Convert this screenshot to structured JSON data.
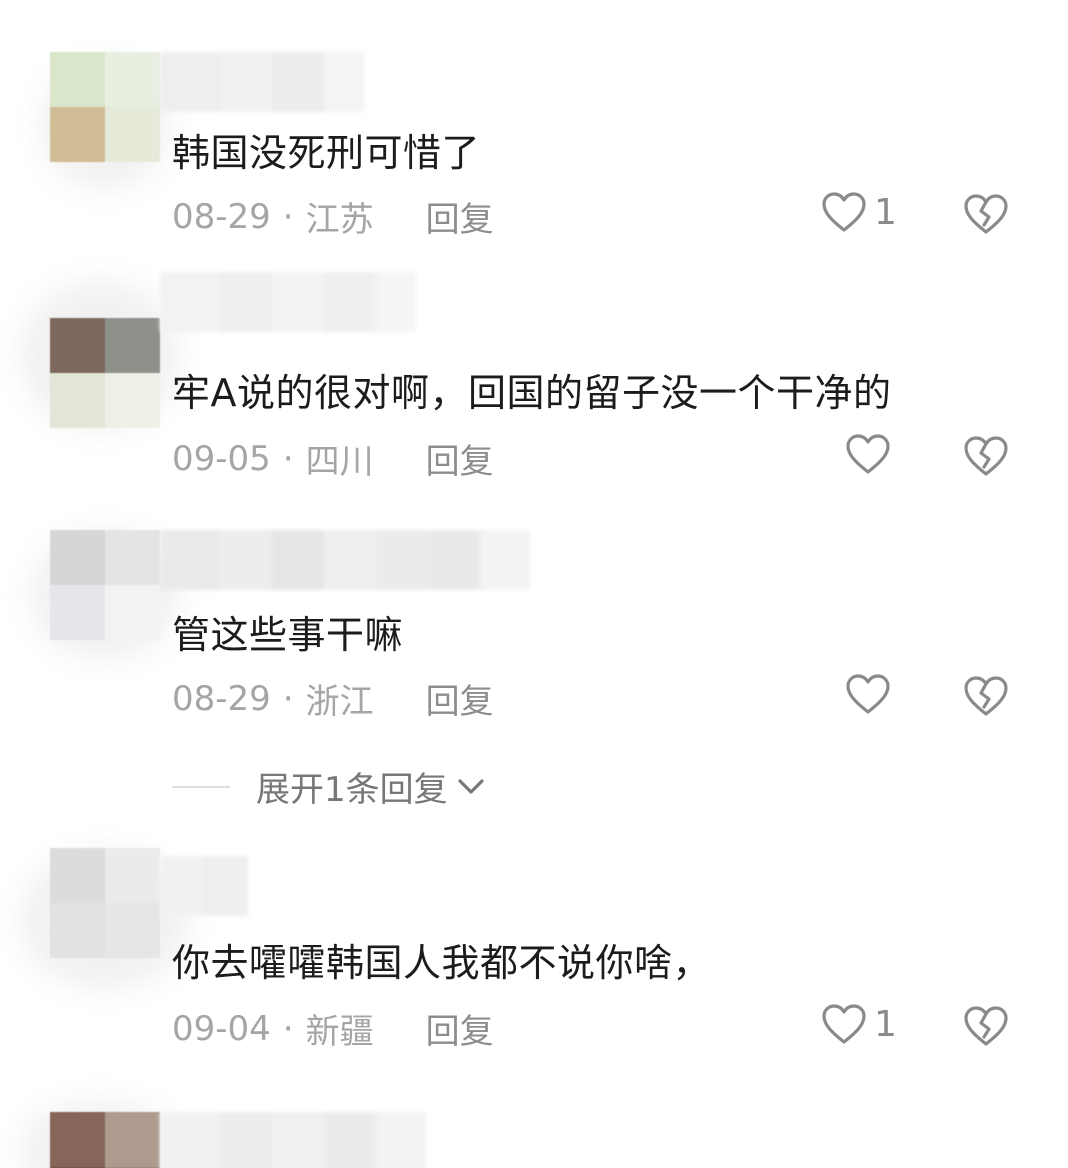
{
  "comments": [
    {
      "text": "韩国没死刑可惜了",
      "date": "08-29",
      "separator": "·",
      "location": "江苏",
      "reply_label": "回复",
      "like_count": "1"
    },
    {
      "text": "牢A说的很对啊，回国的留子没一个干净的",
      "date": "09-05",
      "separator": "·",
      "location": "四川",
      "reply_label": "回复",
      "like_count": ""
    },
    {
      "text": "管这些事干嘛",
      "date": "08-29",
      "separator": "·",
      "location": "浙江",
      "reply_label": "回复",
      "like_count": "",
      "expand_label": "展开1条回复"
    },
    {
      "text": "你去嚯嚯韩国人我都不说你啥，",
      "date": "09-04",
      "separator": "·",
      "location": "新疆",
      "reply_label": "回复",
      "like_count": "1"
    }
  ],
  "icons": {
    "like": "heart-outline-icon",
    "dislike": "broken-heart-icon",
    "expand": "chevron-down-icon"
  },
  "colors": {
    "text": "#1c1c1c",
    "meta": "#a5a5a5",
    "icon": "#8a8a8a"
  }
}
